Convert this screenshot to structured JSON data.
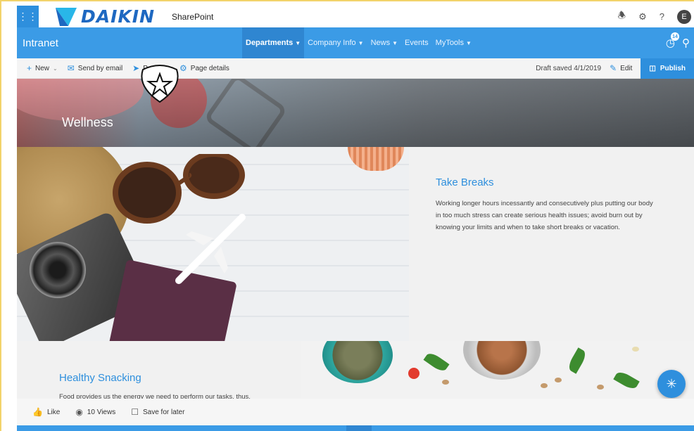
{
  "suite": {
    "brand": "DAIKIN",
    "app_name": "SharePoint",
    "avatar_initial": "E",
    "icons": [
      "waffle-icon",
      "bell-icon",
      "gear-icon",
      "help-icon"
    ]
  },
  "site": {
    "title": "Intranet",
    "nav": [
      {
        "label": "Departments",
        "active": true,
        "dropdown": true
      },
      {
        "label": "Company Info",
        "active": false,
        "dropdown": true
      },
      {
        "label": "News",
        "active": false,
        "dropdown": true
      },
      {
        "label": "Events",
        "active": false,
        "dropdown": false
      },
      {
        "label": "MyTools",
        "active": false,
        "dropdown": true
      }
    ],
    "notification_count": "14"
  },
  "command_bar": {
    "new_label": "New",
    "send_email_label": "Send by email",
    "promote_label": "Promote",
    "page_details_label": "Page details",
    "draft_status": "Draft saved 4/1/2019",
    "edit_label": "Edit",
    "publish_label": "Publish"
  },
  "hero": {
    "title": "Wellness"
  },
  "sections": {
    "breaks": {
      "title": "Take Breaks",
      "text": "Working longer hours incessantly and consecutively plus putting our body in too much stress can create serious health issues; avoid burn out by knowing your limits and when to take short breaks or vacation."
    },
    "snacking": {
      "title": "Healthy Snacking",
      "text": "Food provides us the energy we need to perform our tasks, thus,"
    }
  },
  "footer": {
    "like_label": "Like",
    "views_label": "10 Views",
    "save_label": "Save for later"
  },
  "colors": {
    "accent": "#3b9be6",
    "brand": "#1e68c1",
    "heading": "#2e8fdd"
  }
}
